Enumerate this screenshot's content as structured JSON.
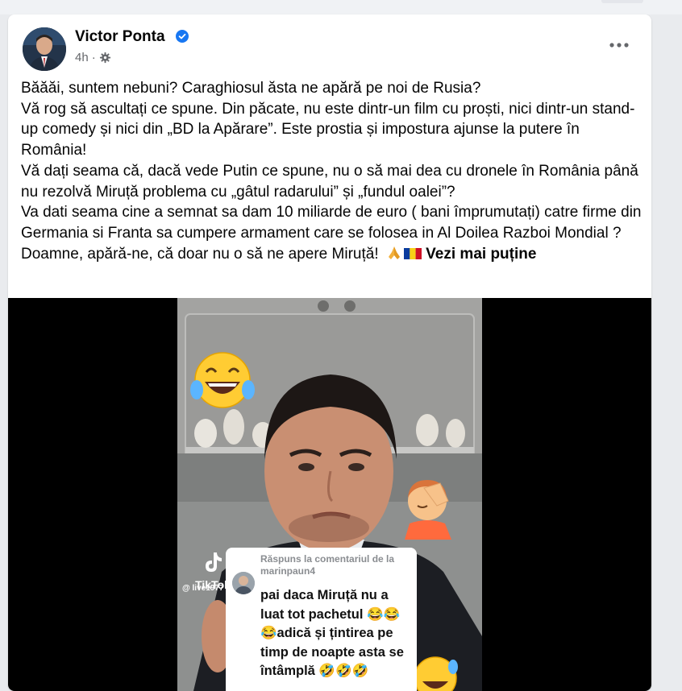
{
  "post": {
    "author": "Victor Ponta",
    "time": "4h",
    "dot": "·",
    "text_lines": [
      "Băăăi, suntem nebuni? Caraghiosul ăsta ne apără pe noi de Rusia?",
      "Vă rog să ascultați ce spune. Din păcate, nu este dintr-un film cu proști, nici dintr-un stand-up comedy și nici din „BD la Apărare”. Este prostia și impostura ajunse la putere în România!",
      "Vă dați seama că, dacă vede Putin ce spune, nu o să mai dea cu dronele în România până nu rezolvă Miruță problema cu „gâtul radarului” și „fundul oalei”?",
      "Va dati seama cine a semnat sa dam 10 miliarde de euro ( bani împrumutați) catre firme din Germania si Franta sa cumpere armament care se folosea in Al Doilea Razboi Mondial ?"
    ],
    "last_line": "Doamne, apără-ne, că doar nu o să ne apere Miruță!",
    "see_less": "Vezi mai puține"
  },
  "video": {
    "tiktok_label": "TikTok",
    "tiktok_handle": "@ live1977",
    "reply_header": "Răspuns la comentariul de la marinpaun4",
    "reply_text": "pai daca Miruță nu a luat tot pachetul 😂😂😂adică și țintirea pe timp de noapte asta se întâmplă 🤣🤣🤣"
  },
  "colors": {
    "verified": "#1877f2",
    "text": "#050505",
    "meta": "#65676b"
  },
  "icons": {
    "verified": "verified-badge-icon",
    "audience": "gear-icon",
    "more": "more-icon",
    "laugh": "laughing-emoji-icon",
    "facepalm": "facepalm-emoji-icon"
  }
}
